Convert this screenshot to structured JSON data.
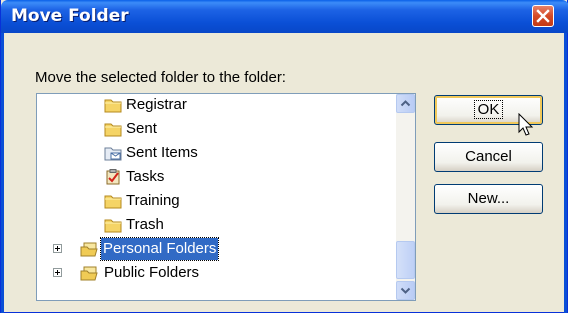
{
  "window": {
    "title": "Move Folder",
    "accent": "#0A4FD6",
    "close_color": "#D44A26"
  },
  "prompt": "Move the selected folder to the folder:",
  "tree": {
    "items": [
      {
        "label": "Registrar",
        "icon": "folder-icon",
        "selected": false
      },
      {
        "label": "Sent",
        "icon": "folder-icon",
        "selected": false
      },
      {
        "label": "Sent Items",
        "icon": "sent-items-icon",
        "selected": false
      },
      {
        "label": "Tasks",
        "icon": "tasks-icon",
        "selected": false
      },
      {
        "label": "Training",
        "icon": "folder-icon",
        "selected": false
      },
      {
        "label": "Trash",
        "icon": "folder-icon",
        "selected": false
      },
      {
        "label": "Personal Folders",
        "icon": "personal-folders-icon",
        "selected": true
      },
      {
        "label": "Public Folders",
        "icon": "public-folders-icon",
        "selected": false
      }
    ],
    "selection_color": "#316AC5"
  },
  "buttons": {
    "ok": "OK",
    "cancel": "Cancel",
    "new": "New..."
  }
}
